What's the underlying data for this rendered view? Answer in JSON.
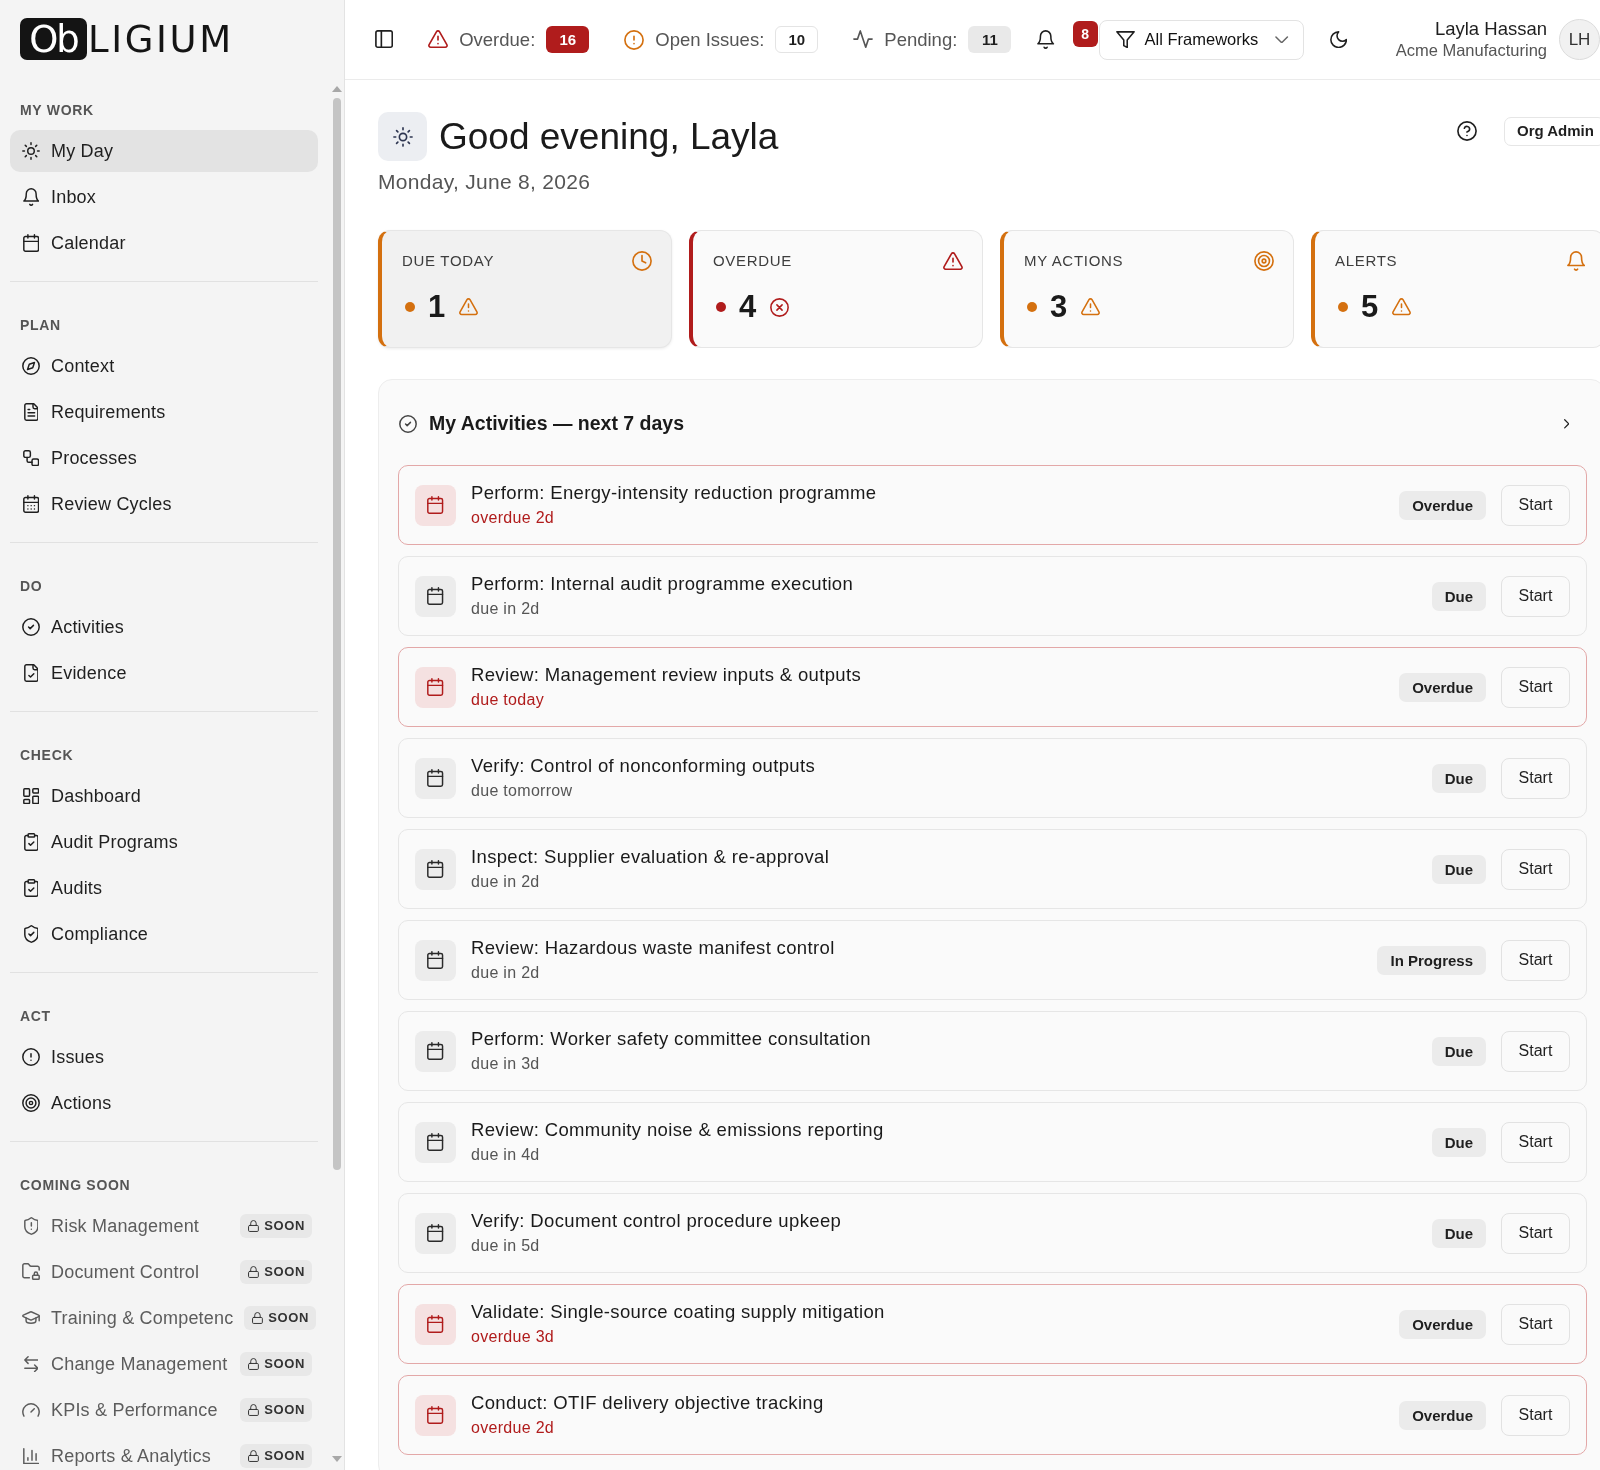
{
  "sidebar": {
    "logo": {
      "mark": "Ob",
      "text": "LIGIUM"
    },
    "sections": [
      {
        "label": "MY WORK",
        "items": [
          {
            "label": "My Day",
            "selected": true,
            "disabled": false
          },
          {
            "label": "Inbox",
            "selected": false,
            "disabled": false
          },
          {
            "label": "Calendar",
            "selected": false,
            "disabled": false
          }
        ]
      },
      {
        "label": "PLAN",
        "items": [
          {
            "label": "Context",
            "selected": false,
            "disabled": false
          },
          {
            "label": "Requirements",
            "selected": false,
            "disabled": false
          },
          {
            "label": "Processes",
            "selected": false,
            "disabled": false
          },
          {
            "label": "Review Cycles",
            "selected": false,
            "disabled": false
          }
        ]
      },
      {
        "label": "DO",
        "items": [
          {
            "label": "Activities",
            "selected": false,
            "disabled": false
          },
          {
            "label": "Evidence",
            "selected": false,
            "disabled": false
          }
        ]
      },
      {
        "label": "CHECK",
        "items": [
          {
            "label": "Dashboard",
            "selected": false,
            "disabled": false
          },
          {
            "label": "Audit Programs",
            "selected": false,
            "disabled": false
          },
          {
            "label": "Audits",
            "selected": false,
            "disabled": false
          },
          {
            "label": "Compliance",
            "selected": false,
            "disabled": false
          }
        ]
      },
      {
        "label": "ACT",
        "items": [
          {
            "label": "Issues",
            "selected": false,
            "disabled": false
          },
          {
            "label": "Actions",
            "selected": false,
            "disabled": false
          }
        ]
      },
      {
        "label": "COMING SOON",
        "items": [
          {
            "label": "Risk Management",
            "selected": false,
            "disabled": true,
            "badge": "SOON"
          },
          {
            "label": "Document Control",
            "selected": false,
            "disabled": true,
            "badge": "SOON"
          },
          {
            "label": "Training & Competenc",
            "selected": false,
            "disabled": true,
            "badge": "SOON"
          },
          {
            "label": "Change Management",
            "selected": false,
            "disabled": true,
            "badge": "SOON"
          },
          {
            "label": "KPIs & Performance",
            "selected": false,
            "disabled": true,
            "badge": "SOON"
          },
          {
            "label": "Reports & Analytics",
            "selected": false,
            "disabled": true,
            "badge": "SOON"
          }
        ]
      }
    ]
  },
  "topbar": {
    "counters": [
      {
        "kind": "danger",
        "label": "Overdue:",
        "count": "16"
      },
      {
        "kind": "warning",
        "label": "Open Issues:",
        "count": "10"
      },
      {
        "kind": "muted",
        "label": "Pending:",
        "count": "11"
      }
    ],
    "notifications": {
      "count": "8"
    },
    "framework_filter": {
      "value": "All Frameworks"
    },
    "user": {
      "name": "Layla Hassan",
      "organization": "Acme Manufacturing",
      "initials": "LH"
    }
  },
  "header": {
    "title": "Good evening, Layla",
    "date": "Monday, June 8, 2026",
    "role": "Org Admin"
  },
  "stat_cards": [
    {
      "label": "DUE TODAY",
      "value": "1",
      "kind": "warning",
      "color": "#d4700f",
      "selected": true
    },
    {
      "label": "OVERDUE",
      "value": "4",
      "kind": "critical",
      "color": "#b01c1c",
      "selected": false
    },
    {
      "label": "MY ACTIONS",
      "value": "3",
      "kind": "warning",
      "color": "#d4700f",
      "selected": false
    },
    {
      "label": "ALERTS",
      "value": "5",
      "kind": "warning",
      "color": "#d4700f",
      "selected": false
    }
  ],
  "activities": {
    "title": "My Activities — next 7 days",
    "rows": [
      {
        "title": "Perform: Energy-intensity reduction programme",
        "due": "overdue 2d",
        "status": "Overdue",
        "overdue": true,
        "action": "Start"
      },
      {
        "title": "Perform: Internal audit programme execution",
        "due": "due in 2d",
        "status": "Due",
        "overdue": false,
        "action": "Start"
      },
      {
        "title": "Review: Management review inputs & outputs",
        "due": "due today",
        "status": "Overdue",
        "overdue": true,
        "action": "Start"
      },
      {
        "title": "Verify: Control of nonconforming outputs",
        "due": "due tomorrow",
        "status": "Due",
        "overdue": false,
        "action": "Start"
      },
      {
        "title": "Inspect: Supplier evaluation & re-approval",
        "due": "due in 2d",
        "status": "Due",
        "overdue": false,
        "action": "Start"
      },
      {
        "title": "Review: Hazardous waste manifest control",
        "due": "due in 2d",
        "status": "In Progress",
        "overdue": false,
        "action": "Start"
      },
      {
        "title": "Perform: Worker safety committee consultation",
        "due": "due in 3d",
        "status": "Due",
        "overdue": false,
        "action": "Start"
      },
      {
        "title": "Review: Community noise & emissions reporting",
        "due": "due in 4d",
        "status": "Due",
        "overdue": false,
        "action": "Start"
      },
      {
        "title": "Verify: Document control procedure upkeep",
        "due": "due in 5d",
        "status": "Due",
        "overdue": false,
        "action": "Start"
      },
      {
        "title": "Validate: Single-source coating supply mitigation",
        "due": "overdue 3d",
        "status": "Overdue",
        "overdue": true,
        "action": "Start"
      },
      {
        "title": "Conduct: OTIF delivery objective tracking",
        "due": "overdue 2d",
        "status": "Overdue",
        "overdue": true,
        "action": "Start"
      }
    ]
  }
}
